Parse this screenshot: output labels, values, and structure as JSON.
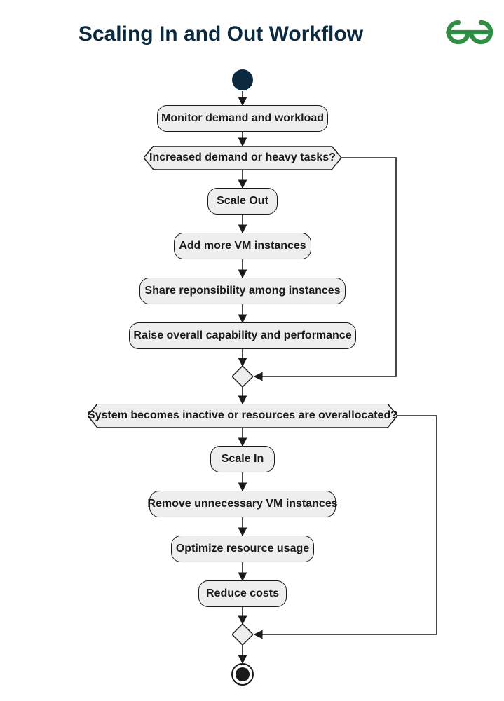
{
  "title": "Scaling In and Out Workflow",
  "logo": {
    "name": "geeksforgeeks-logo",
    "color": "#2f8d46"
  },
  "nodes": {
    "n1": "Monitor demand and workload",
    "d1": "Increased demand or heavy tasks?",
    "n2": "Scale Out",
    "n3": "Add more VM instances",
    "n4": "Share reponsibility among instances",
    "n5": "Raise overall capability and performance",
    "d2": "System becomes inactive or resources are overallocated?",
    "n6": "Scale In",
    "n7": "Remove unnecessary VM instances",
    "n8": "Optimize resource usage",
    "n9": "Reduce costs"
  },
  "chart_data": {
    "type": "flowchart",
    "title": "Scaling In and Out Workflow",
    "nodes": [
      {
        "id": "start",
        "kind": "initial"
      },
      {
        "id": "n1",
        "kind": "process",
        "label": "Monitor demand and workload"
      },
      {
        "id": "d1",
        "kind": "decision",
        "label": "Increased demand or heavy tasks?"
      },
      {
        "id": "n2",
        "kind": "process",
        "label": "Scale Out"
      },
      {
        "id": "n3",
        "kind": "process",
        "label": "Add more VM instances"
      },
      {
        "id": "n4",
        "kind": "process",
        "label": "Share reponsibility among instances"
      },
      {
        "id": "n5",
        "kind": "process",
        "label": "Raise overall capability and performance"
      },
      {
        "id": "m1",
        "kind": "merge"
      },
      {
        "id": "d2",
        "kind": "decision",
        "label": "System becomes inactive or resources are overallocated?"
      },
      {
        "id": "n6",
        "kind": "process",
        "label": "Scale In"
      },
      {
        "id": "n7",
        "kind": "process",
        "label": "Remove unnecessary VM instances"
      },
      {
        "id": "n8",
        "kind": "process",
        "label": "Optimize resource usage"
      },
      {
        "id": "n9",
        "kind": "process",
        "label": "Reduce costs"
      },
      {
        "id": "m2",
        "kind": "merge"
      },
      {
        "id": "end",
        "kind": "final"
      }
    ],
    "edges": [
      {
        "from": "start",
        "to": "n1"
      },
      {
        "from": "n1",
        "to": "d1"
      },
      {
        "from": "d1",
        "to": "n2",
        "branch": "yes"
      },
      {
        "from": "d1",
        "to": "m1",
        "branch": "no",
        "routing": "right-bypass"
      },
      {
        "from": "n2",
        "to": "n3"
      },
      {
        "from": "n3",
        "to": "n4"
      },
      {
        "from": "n4",
        "to": "n5"
      },
      {
        "from": "n5",
        "to": "m1"
      },
      {
        "from": "m1",
        "to": "d2"
      },
      {
        "from": "d2",
        "to": "n6",
        "branch": "yes"
      },
      {
        "from": "d2",
        "to": "m2",
        "branch": "no",
        "routing": "right-bypass"
      },
      {
        "from": "n6",
        "to": "n7"
      },
      {
        "from": "n7",
        "to": "n8"
      },
      {
        "from": "n8",
        "to": "n9"
      },
      {
        "from": "n9",
        "to": "m2"
      },
      {
        "from": "m2",
        "to": "end"
      }
    ]
  }
}
